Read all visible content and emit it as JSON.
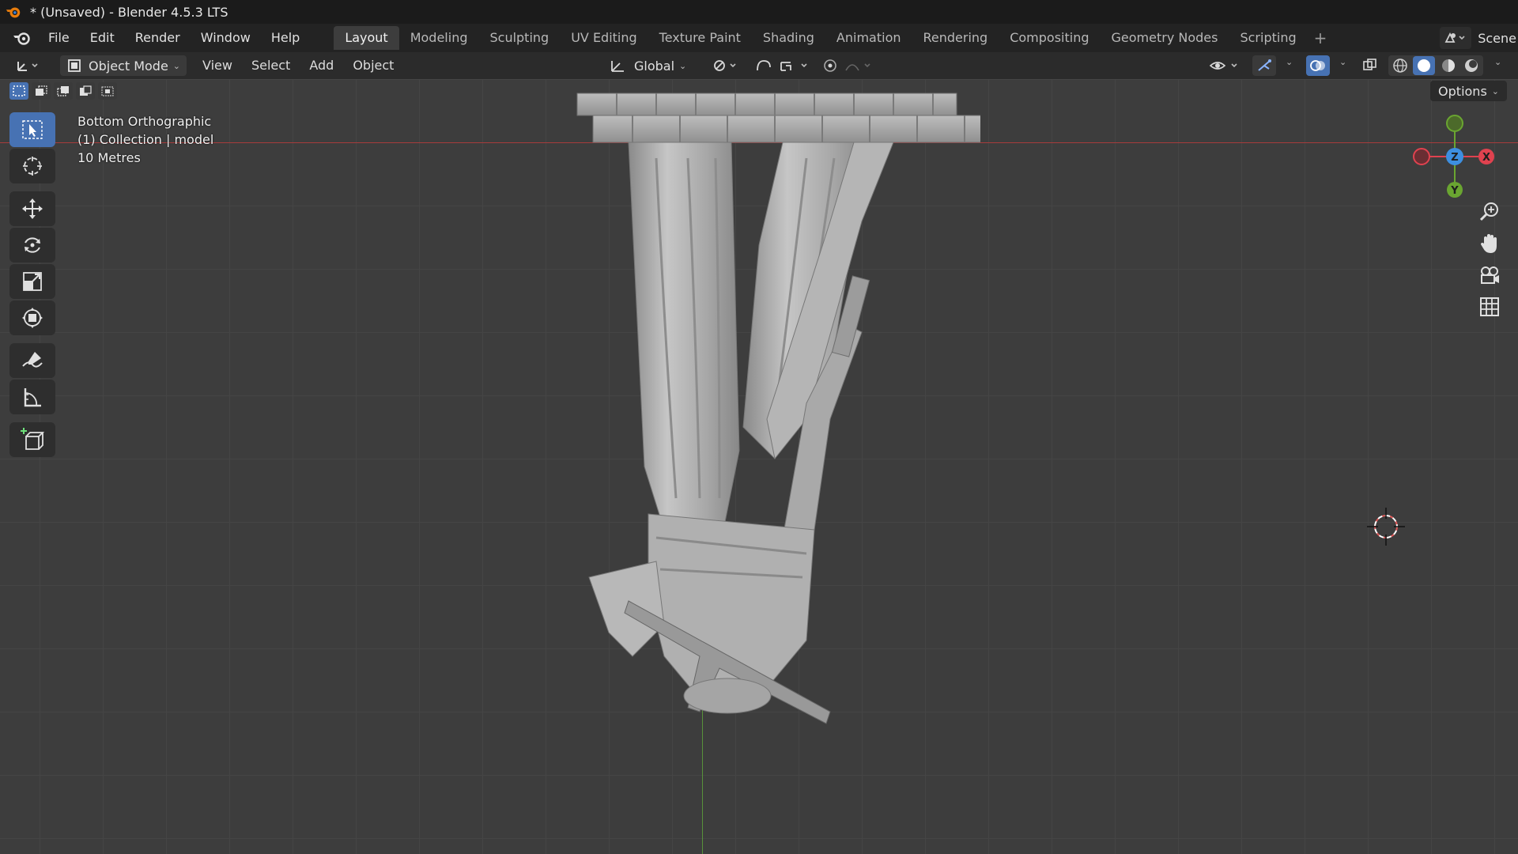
{
  "window": {
    "title": "* (Unsaved) - Blender 4.5.3 LTS"
  },
  "menu": [
    "File",
    "Edit",
    "Render",
    "Window",
    "Help"
  ],
  "workspaces": [
    {
      "label": "Layout",
      "active": true
    },
    {
      "label": "Modeling"
    },
    {
      "label": "Sculpting"
    },
    {
      "label": "UV Editing"
    },
    {
      "label": "Texture Paint"
    },
    {
      "label": "Shading"
    },
    {
      "label": "Animation"
    },
    {
      "label": "Rendering"
    },
    {
      "label": "Compositing"
    },
    {
      "label": "Geometry Nodes"
    },
    {
      "label": "Scripting"
    }
  ],
  "scene": {
    "label": "Scene"
  },
  "header": {
    "mode": "Object Mode",
    "view": "View",
    "select": "Select",
    "add": "Add",
    "object": "Object",
    "transform_orientation": "Global"
  },
  "viewport": {
    "view_name": "Bottom Orthographic",
    "collection": "(1) Collection | model",
    "scale": "10 Metres",
    "options_label": "Options"
  },
  "gizmo": {
    "x_label": "X",
    "y_label": "Y",
    "z_label": "Z"
  },
  "colors": {
    "accent": "#4772b3",
    "x_axis": "#e0424f",
    "y_axis": "#6aa531",
    "z_axis": "#3d8fe0"
  },
  "tools": [
    "select-box-icon",
    "cursor-icon",
    "move-icon",
    "rotate-icon",
    "scale-icon",
    "transform-icon",
    "annotate-icon",
    "measure-icon",
    "add-cube-icon"
  ]
}
